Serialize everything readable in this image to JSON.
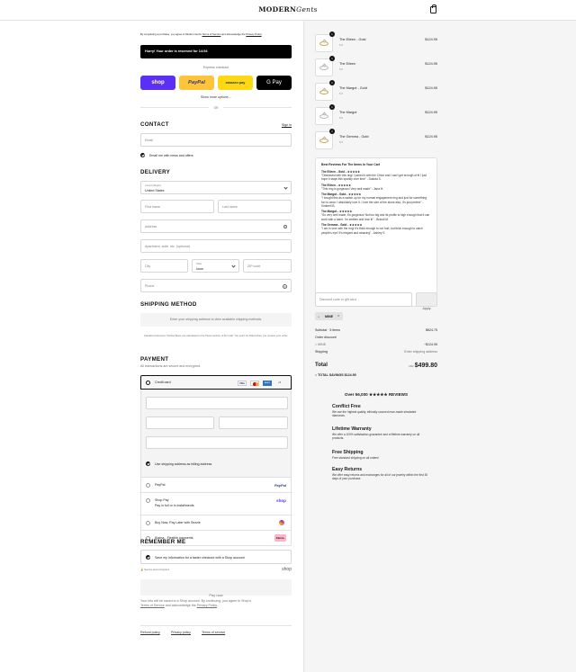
{
  "header": {
    "brand_main": "MODERN",
    "brand_script": "Gents",
    "cart_icon": "shopping-bag-icon"
  },
  "left": {
    "terms_notice": {
      "prefix": "By completing a purchase, you agree to Modern Gents ",
      "terms_link": "Terms of Service",
      "middle": " and acknowledge the ",
      "privacy_link": "Privacy Policy",
      "suffix": "."
    },
    "reservation_banner": "Hurry! Your order is reserved for 14:54",
    "express_checkout": "Express checkout",
    "express_buttons": {
      "shop": "shop",
      "paypal": "PayPal",
      "amazon": "amazon pay",
      "gpay": "G Pay"
    },
    "show_more": "Show more options",
    "or": "OR",
    "contact": {
      "heading": "CONTACT",
      "sign_in": "Sign in",
      "email_placeholder": "Email",
      "news_optin": "Email me with news and offers"
    },
    "delivery": {
      "heading": "DELIVERY",
      "country_label": "Country/Region",
      "country_value": "United States",
      "first_name": "First name",
      "last_name": "Last name",
      "address": "Address",
      "apartment": "Apartment, suite, etc. (optional)",
      "city": "City",
      "state_label": "State",
      "state_value": "Iowa",
      "zip": "ZIP code",
      "phone": "Phone"
    },
    "shipping": {
      "heading": "SHIPPING METHOD",
      "placeholder": "Enter your shipping address to view available shipping methods.",
      "note": "Canada Customers: Duties/Taxes are calculated in the Taxes section of the total. You won't be billed when you receive your order."
    },
    "payment": {
      "heading": "PAYMENT",
      "subheading": "All transactions are secure and encrypted.",
      "credit_card": "Credit card",
      "more_cards": "+5",
      "billing_same": "Use shipping address as billing address",
      "paypal": "PayPal",
      "paypal_logo": "PayPal",
      "shop_pay": "Shop Pay",
      "shop_pay_sub": "Pay in full or in installments",
      "shop_logo": "shop",
      "sezzle": "Buy Now, Pay Later with Sezzle",
      "klarna": "Klarna - Flexible payments",
      "klarna_logo": "Klarna."
    },
    "remember": {
      "heading": "REMEMBER ME",
      "save_info": "Save my information for a faster checkout with a Shop account",
      "secure": "Secure and encrypted",
      "shop_logo": "shop"
    },
    "pay_now": "Pay now",
    "shop_terms": {
      "line1": "Your info will be saved to a Shop account. By continuing, you agree to Shop's",
      "terms": "Terms of Service",
      "middle": " and acknowledge the ",
      "privacy": "Privacy Policy",
      "suffix": "."
    },
    "footer_links": [
      "Refund policy",
      "Privacy policy",
      "Terms of service"
    ]
  },
  "right": {
    "products": [
      {
        "name": "The Eileen - Gold",
        "variant": "5.5",
        "price": "$124.95",
        "qty": "1"
      },
      {
        "name": "The Eileen",
        "variant": "5.5",
        "price": "$124.95",
        "qty": "1"
      },
      {
        "name": "The Margot - Gold",
        "variant": "5.5",
        "price": "$124.95",
        "qty": "1"
      },
      {
        "name": "The Margot",
        "variant": "5.5",
        "price": "$124.95",
        "qty": "1"
      },
      {
        "name": "The Gemma - Gold",
        "variant": "5.5",
        "price": "$124.95",
        "qty": "1"
      }
    ],
    "reviews": {
      "title": "Best Reviews For The Items In Your Cart",
      "items": [
        {
          "name": "The Eileen - Gold - ★★★★★",
          "text": "\"Obsessed with this ring! I paired it with the Chloe and I can't get enough of it! I just hope it stays this sparkly over time\" - Dakota S."
        },
        {
          "name": "The Eileen - ★★★★★",
          "text": "\"This ring is gorgeous! Very well made\" - Jana H."
        },
        {
          "name": "The Margot - Gold - ★★★★★",
          "text": "\"I bought this as a switch up for my normal engagement ring and just for something fun to wear. I absolutely love it. I love the size of the stone also, it's just perfect\" - Kimberli B."
        },
        {
          "name": "The Margot - ★★★★★",
          "text": "\"So very well made, it's gorgeous! Not too big and its profile is high enough that it can work with a band. I'm smitten and love it!\" - Brandi M."
        },
        {
          "name": "The Gemma - Gold - ★★★★★",
          "text": "\"I am in love with the ring! It's thick enough to not hurt, but thick enough to catch people's eye! It's elegant and amazing\" - Ashley S."
        }
      ]
    },
    "discount": {
      "placeholder": "Discount code or gift card",
      "apply": "Apply",
      "applied_code": "MINE"
    },
    "summary": {
      "subtotal_label": "Subtotal · 5 items",
      "subtotal_value": "$624.75",
      "order_discount_label": "Order discount",
      "code_label": "MINE",
      "code_value": "−$124.95",
      "shipping_label": "Shipping",
      "shipping_value": "Enter shipping address",
      "total_label": "Total",
      "currency": "USD",
      "total_value": "$499.80",
      "savings_label": "TOTAL SAVINGS",
      "savings_value": "$124.95"
    },
    "trust": {
      "heading": "Over 56,000 ★★★★★ REVIEWS",
      "features": [
        {
          "title": "Conflict Free",
          "text": "We use the highest quality, ethically sourced man-made simulated diamonds."
        },
        {
          "title": "Lifetime Warranty",
          "text": "We offer a 100% satisfaction guarantee and a lifetime warranty on all products."
        },
        {
          "title": "Free Shipping",
          "text": "Free standard shipping on all orders!"
        },
        {
          "title": "Easy Returns",
          "text": "We offer easy returns and exchanges for all of our jewelry within the first 30 days of your purchase."
        }
      ]
    }
  },
  "colors": {
    "shop_purple": "#5a31f4",
    "paypal_yellow": "#ffc439",
    "amazon_yellow": "#ffd814",
    "gpay_black": "#000000",
    "gold": "#c9a54a",
    "klarna_pink": "#ffb3c7"
  }
}
